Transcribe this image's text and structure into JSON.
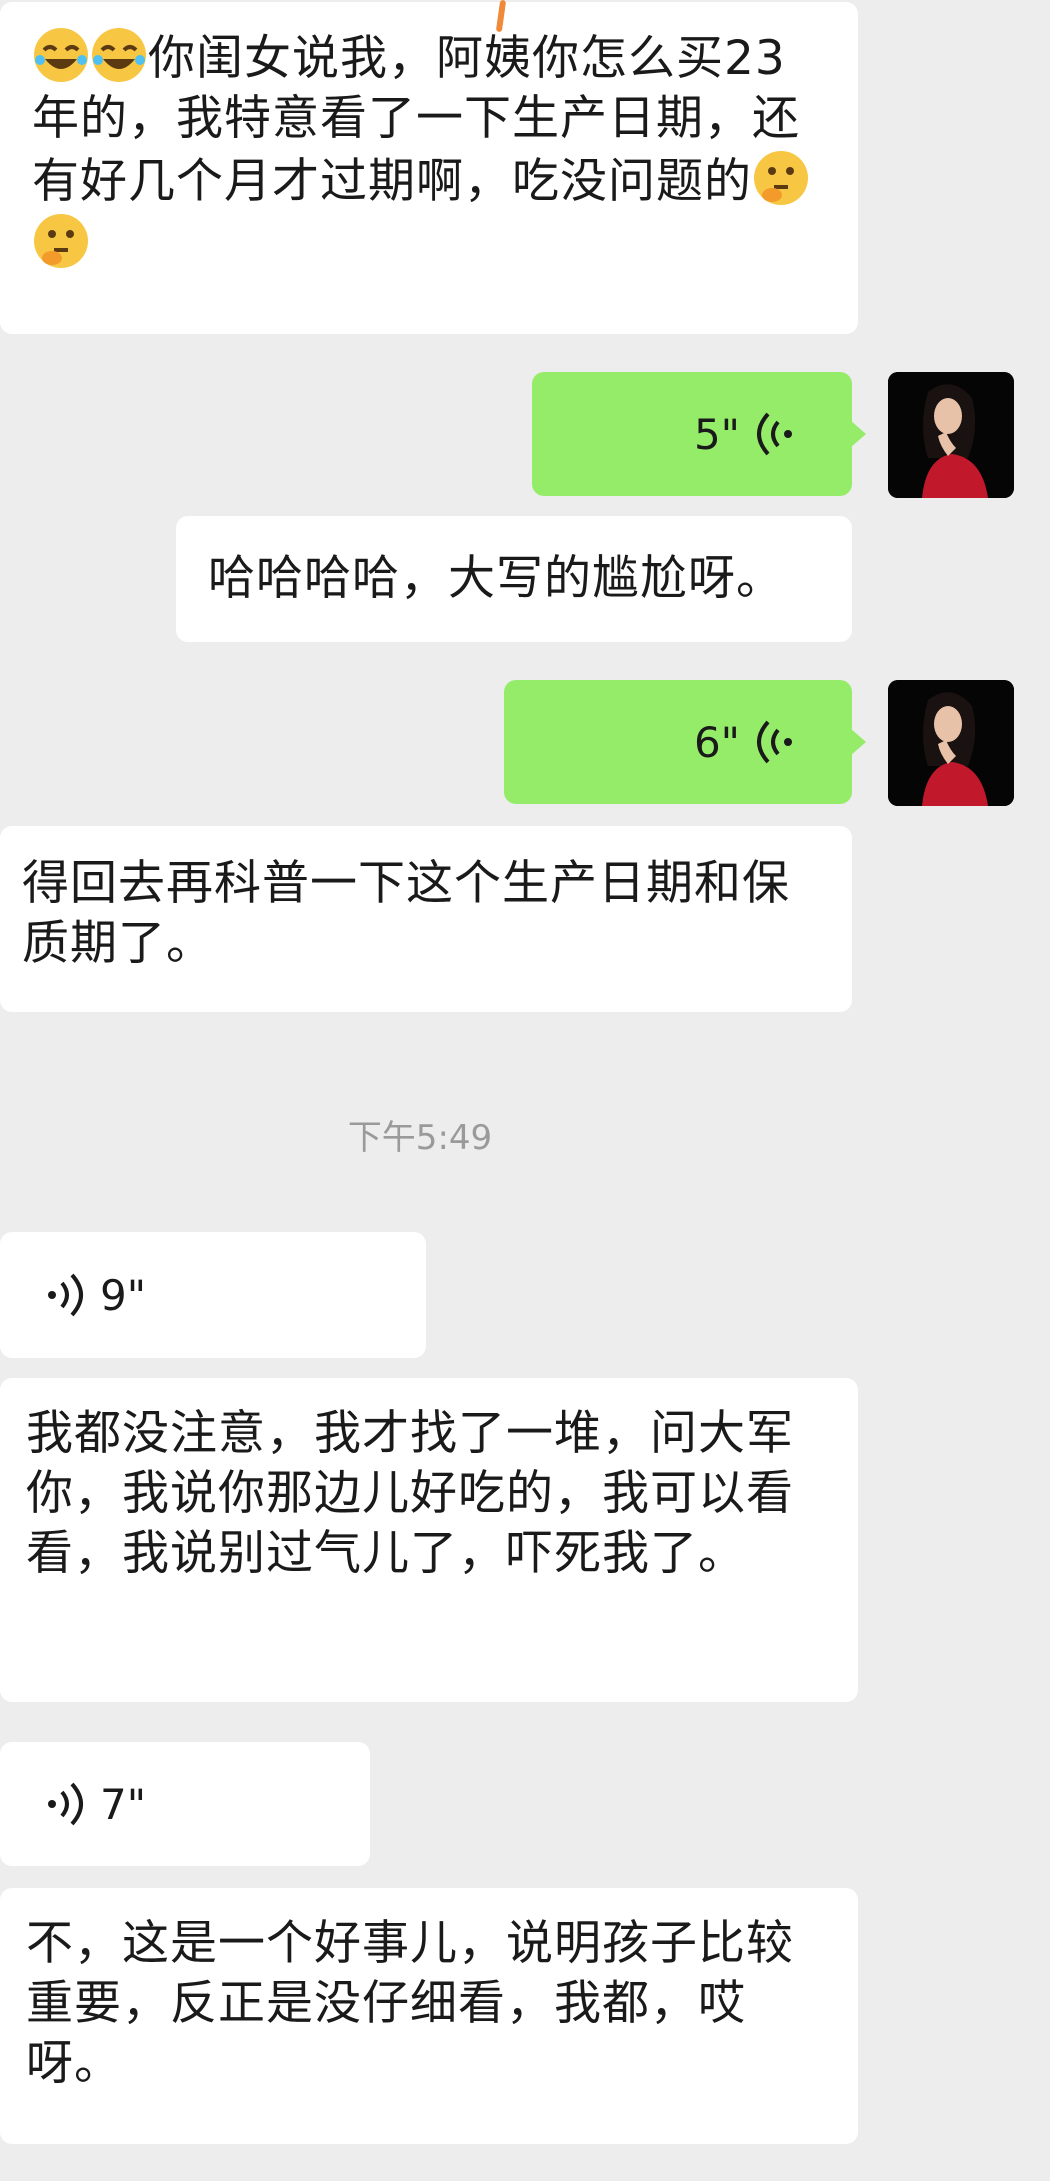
{
  "messages": [
    {
      "id": "m1",
      "side": "left",
      "type": "text",
      "text_after_emoji": "你闺女说我，阿姨你怎么买23年的，我特意看了一下生产日期，还有好几个月才过期啊，吃没问题的",
      "emoji_lead": [
        "joy",
        "joy"
      ],
      "emoji_trail": [
        "thinking",
        "thinking"
      ]
    },
    {
      "id": "m2",
      "side": "right",
      "type": "voice",
      "duration": "5\""
    },
    {
      "id": "m3",
      "side": "right",
      "type": "text",
      "text": "哈哈哈哈，大写的尴尬呀。"
    },
    {
      "id": "m4",
      "side": "right",
      "type": "voice",
      "duration": "6\""
    },
    {
      "id": "m5",
      "side": "left",
      "type": "text",
      "text": "得回去再科普一下这个生产日期和保质期了。"
    },
    {
      "id": "m6",
      "side": "left",
      "type": "voice",
      "duration": "9\""
    },
    {
      "id": "m7",
      "side": "left",
      "type": "text",
      "text": "我都没注意，我才找了一堆，问大军你，我说你那边儿好吃的，我可以看看，我说别过气儿了，吓死我了。"
    },
    {
      "id": "m8",
      "side": "left",
      "type": "voice",
      "duration": "7\""
    },
    {
      "id": "m9",
      "side": "left",
      "type": "text",
      "text": "不，这是一个好事儿，说明孩子比较重要，反正是没仔细看，我都，哎呀。"
    }
  ],
  "timestamp": "下午5:49",
  "colors": {
    "background": "#ededed",
    "bubble_in": "#ffffff",
    "bubble_out": "#95ec69",
    "timestamp": "#9a9a9a"
  },
  "icons": {
    "voice_out": "voice-wave-icon-left",
    "voice_in": "voice-wave-icon-right",
    "avatar": "user-avatar",
    "emoji": [
      "face-with-tears-of-joy",
      "thinking-face"
    ]
  }
}
